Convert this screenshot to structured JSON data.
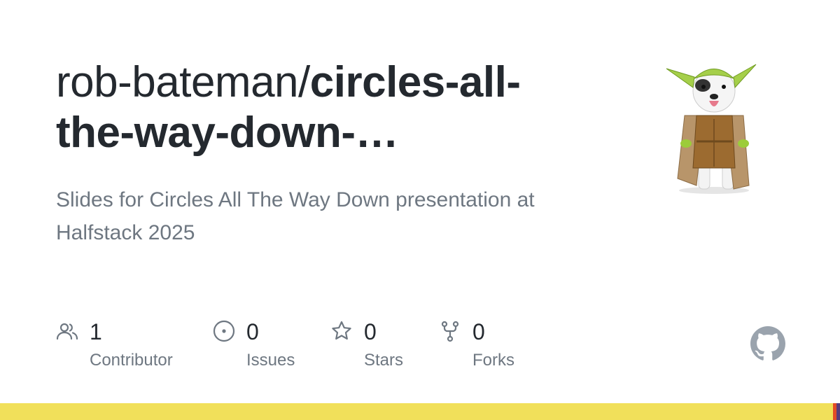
{
  "repo": {
    "owner": "rob-bateman/",
    "name": "circles-all-the-way-down-…",
    "description": "Slides for Circles All The Way Down presentation at Halfstack 2025"
  },
  "stats": [
    {
      "icon": "people-icon",
      "count": "1",
      "label": "Contributor"
    },
    {
      "icon": "issue-circle-icon",
      "count": "0",
      "label": "Issues"
    },
    {
      "icon": "star-icon",
      "count": "0",
      "label": "Stars"
    },
    {
      "icon": "fork-icon",
      "count": "0",
      "label": "Forks"
    }
  ],
  "colors": {
    "language_bar": "#f1e05a",
    "language_accent_1": "#e34c26",
    "language_accent_2": "#563d7c",
    "title_text": "#24292f",
    "muted_text": "#6e7781"
  },
  "logo": {
    "icon": "github-mark-icon"
  },
  "avatar": {
    "icon": "dog-in-yoda-costume-avatar"
  }
}
